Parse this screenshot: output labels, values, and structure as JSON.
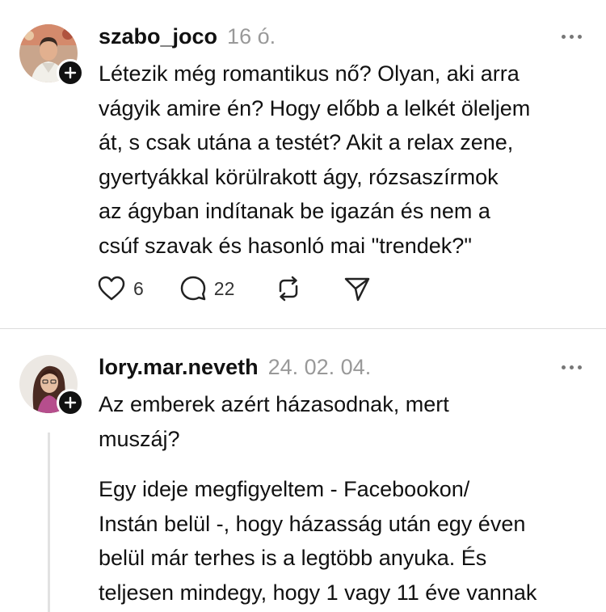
{
  "posts": [
    {
      "username": "szabo_joco",
      "time": "16 ó.",
      "lines": [
        "Létezik még romantikus nő? Olyan, aki arra",
        "vágyik amire én? Hogy előbb a lelkét öleljem",
        "át, s csak utána a testét? Akit a relax zene,",
        "gyertyákkal körülrakott ágy, rózsaszírmok",
        "az ágyban indítanak be igazán és nem a",
        "csúf szavak és hasonló mai \"trendek?\""
      ],
      "likes": "6",
      "comments": "22"
    },
    {
      "username": "lory.mar.neveth",
      "time": "24. 02. 04.",
      "lines": [
        "Az emberek azért házasodnak, mert",
        "muszáj?"
      ],
      "lines2": [
        "Egy ideje megfigyeltem - Facebookon/",
        "Instán belül -, hogy házasság után egy éven",
        "belül már terhes is a legtöbb anyuka. És",
        "teljesen mindegy, hogy 1 vagy 11 éve vannak"
      ]
    }
  ],
  "icons": [
    "heart-icon",
    "comment-icon",
    "repost-icon",
    "share-icon",
    "more-icon",
    "follow-plus-icon"
  ]
}
